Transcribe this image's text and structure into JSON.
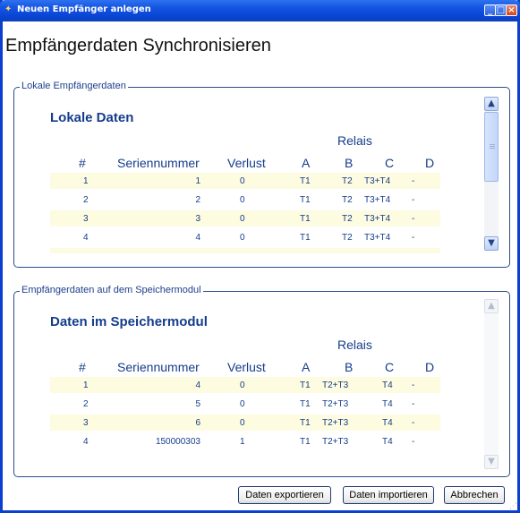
{
  "window": {
    "title": "Neuen Empfänger anlegen"
  },
  "heading": "Empfängerdaten Synchronisieren",
  "columns": {
    "num": "#",
    "serial": "Seriennummer",
    "loss": "Verlust",
    "a": "A",
    "b": "B",
    "c": "C",
    "d": "D",
    "group": "Relais"
  },
  "local": {
    "legend": "Lokale Empfängerdaten",
    "title": "Lokale Daten",
    "rows": [
      {
        "num": "1",
        "serial": "1",
        "loss": "0",
        "a": "T1",
        "b": "T2",
        "c": "T3+T4",
        "d": "-"
      },
      {
        "num": "2",
        "serial": "2",
        "loss": "0",
        "a": "T1",
        "b": "T2",
        "c": "T3+T4",
        "d": "-"
      },
      {
        "num": "3",
        "serial": "3",
        "loss": "0",
        "a": "T1",
        "b": "T2",
        "c": "T3+T4",
        "d": "-"
      },
      {
        "num": "4",
        "serial": "4",
        "loss": "0",
        "a": "T1",
        "b": "T2",
        "c": "T3+T4",
        "d": "-"
      }
    ]
  },
  "module": {
    "legend": "Empfängerdaten auf dem Speichermodul",
    "title": "Daten im Speichermodul",
    "rows": [
      {
        "num": "1",
        "serial": "4",
        "loss": "0",
        "a": "T1",
        "b": "T2+T3",
        "c": "T4",
        "d": "-"
      },
      {
        "num": "2",
        "serial": "5",
        "loss": "0",
        "a": "T1",
        "b": "T2+T3",
        "c": "T4",
        "d": "-"
      },
      {
        "num": "3",
        "serial": "6",
        "loss": "0",
        "a": "T1",
        "b": "T2+T3",
        "c": "T4",
        "d": "-"
      },
      {
        "num": "4",
        "serial": "150000303",
        "loss": "1",
        "a": "T1",
        "b": "T2+T3",
        "c": "T4",
        "d": "-"
      }
    ]
  },
  "buttons": {
    "export": "Daten exportieren",
    "import": "Daten importieren",
    "cancel": "Abbrechen"
  },
  "colors": {
    "titlebar": "#0a47d8",
    "accent_text": "#143c8c",
    "row_alt": "#fdfbe0"
  }
}
